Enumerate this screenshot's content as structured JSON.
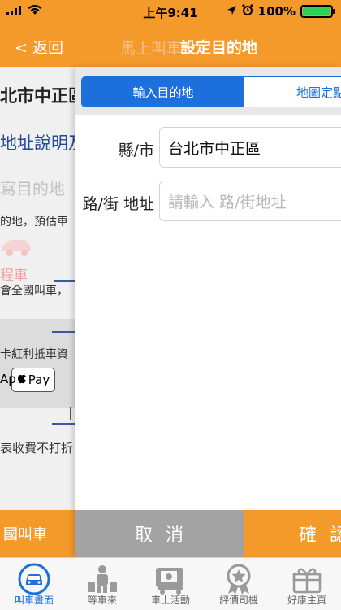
{
  "status_bar": {
    "time": "上午9:41",
    "battery": "100%",
    "battery_level": 1.0,
    "signal": "••ll"
  },
  "nav": {
    "back_label": "< 返回",
    "underlying_title": "馬上叫車",
    "title": "設定目的地"
  },
  "background_page": {
    "address": "北市中正區",
    "address_desc": "地址說明及",
    "destination_placeholder": "寫目的地",
    "estimate_text": "的地，預估車",
    "taxi_label": "程車",
    "nationwide_text": "會全國叫車，",
    "red_envelope_text": "卡紅利抵車資",
    "apple_pay": "Pay",
    "apple_pay_suffix": "Ap",
    "fee_text": "表收費不打折",
    "call_button": "國叫車"
  },
  "segment": {
    "tabs": [
      {
        "label": "輸入目的地",
        "active": true
      },
      {
        "label": "地圖定點",
        "active": false
      }
    ]
  },
  "form": {
    "city": {
      "label": "縣/市",
      "value": "台北市中正區"
    },
    "street": {
      "label": "路/街 地址",
      "value": "",
      "placeholder": "請輸入 路/街地址"
    }
  },
  "footer": {
    "cancel_label": "取消",
    "confirm_label": "確認"
  },
  "tab_bar": {
    "items": [
      {
        "label": "叫車畫面",
        "icon": "car-icon",
        "active": true
      },
      {
        "label": "等車來",
        "icon": "waiting-person-icon",
        "active": false
      },
      {
        "label": "車上活動",
        "icon": "in-car-activity-icon",
        "active": false
      },
      {
        "label": "評價司機",
        "icon": "rating-medal-icon",
        "active": false
      },
      {
        "label": "好康主頁",
        "icon": "gift-icon",
        "active": false
      }
    ]
  },
  "colors": {
    "brand_orange": "#f39a2b",
    "accent_blue": "#1c6fdd",
    "cancel_gray": "#a3a3a3"
  }
}
